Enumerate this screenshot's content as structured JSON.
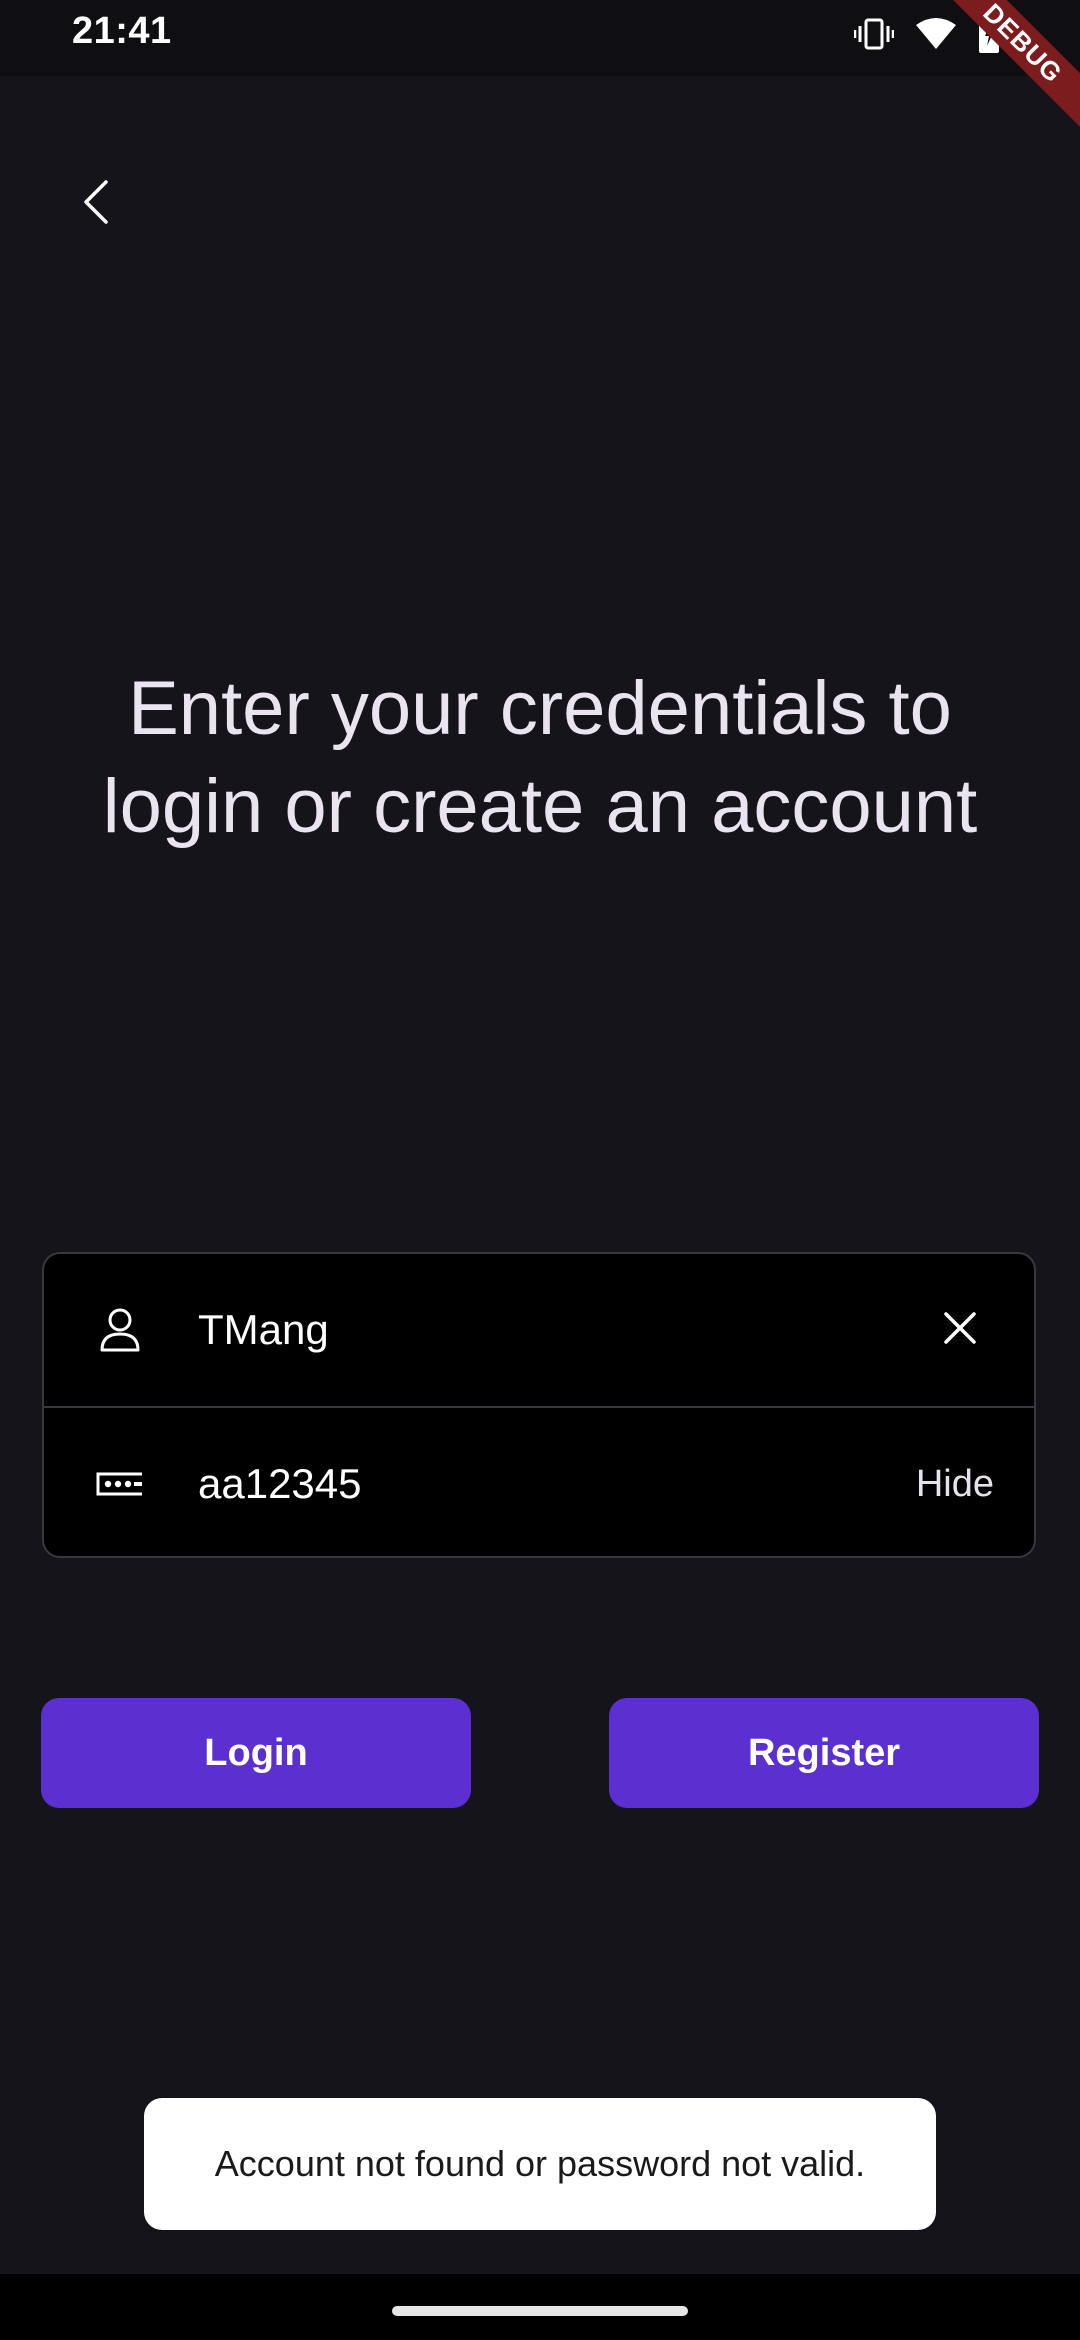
{
  "status_bar": {
    "time": "21:41",
    "icons": [
      "vibrate-icon",
      "wifi-icon",
      "battery-charging-icon"
    ]
  },
  "debug_banner": "DEBUG",
  "heading": "Enter your credentials to login or create an account",
  "form": {
    "username": {
      "value": "TMang",
      "icon": "person-icon",
      "clear_icon": "close-icon"
    },
    "password": {
      "value": "aa12345",
      "icon": "password-dots-icon",
      "toggle_label": "Hide"
    }
  },
  "buttons": {
    "login": "Login",
    "register": "Register"
  },
  "snackbar": {
    "message": "Account not found or password not valid."
  },
  "colors": {
    "background": "#16141b",
    "accent": "#5b2fd0",
    "field_background": "#000000",
    "debug_banner": "#7c1c1e"
  }
}
